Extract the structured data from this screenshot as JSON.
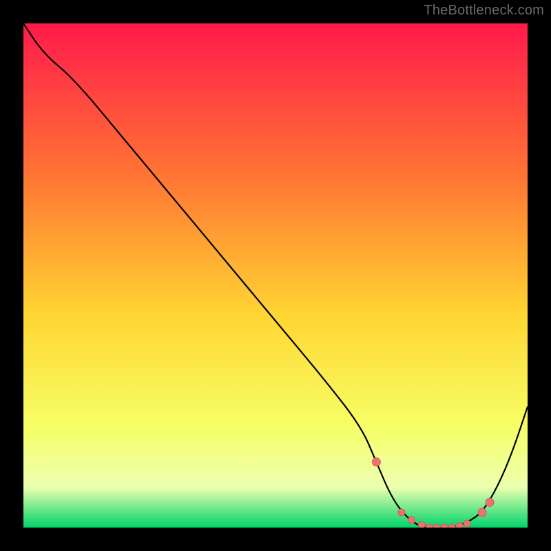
{
  "attribution": "TheBottleneck.com",
  "colors": {
    "gradient_top": "#ff1a4b",
    "gradient_mid_upper": "#ff7a33",
    "gradient_mid": "#ffd633",
    "gradient_lower": "#f7ff66",
    "gradient_band_pale": "#ecffb0",
    "gradient_bottom": "#00d46a",
    "curve": "#000000",
    "marker_fill": "#e87373",
    "marker_stroke": "#d85a5a",
    "background": "#000000"
  },
  "chart_data": {
    "type": "line",
    "title": "",
    "xlabel": "",
    "ylabel": "",
    "xlim": [
      0,
      100
    ],
    "ylim": [
      0,
      100
    ],
    "grid": false,
    "legend": false,
    "series": [
      {
        "name": "bottleneck-curve",
        "x": [
          0,
          4,
          10,
          20,
          30,
          40,
          50,
          60,
          67,
          70,
          73,
          76,
          79,
          82,
          85,
          88,
          91,
          94,
          97,
          100
        ],
        "y": [
          100,
          94,
          89,
          77,
          65,
          53,
          41,
          29,
          20,
          13,
          6,
          2,
          0,
          0,
          0,
          1,
          3,
          8,
          15,
          24
        ]
      }
    ],
    "markers": {
      "name": "highlight-dots",
      "x": [
        70,
        75,
        77,
        79,
        80.5,
        82,
        83.5,
        85,
        86.5,
        88,
        91,
        92.5
      ],
      "y": [
        13,
        3,
        1.5,
        0.5,
        0,
        0,
        0,
        0,
        0.3,
        0.8,
        3,
        5
      ]
    }
  }
}
